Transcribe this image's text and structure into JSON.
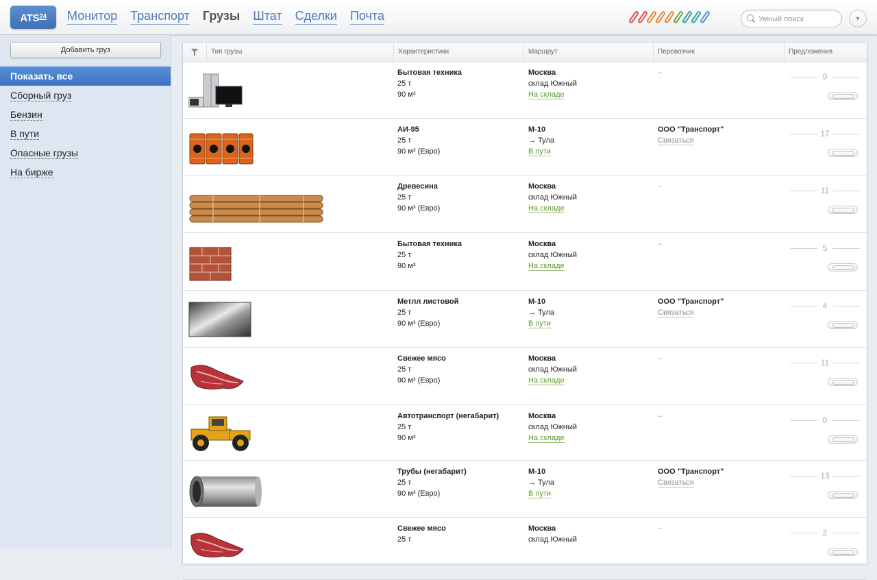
{
  "header": {
    "logo": "ATS",
    "logo_sup": "24",
    "nav": [
      {
        "label": "Монитор",
        "active": false
      },
      {
        "label": "Транспорт",
        "active": false
      },
      {
        "label": "Грузы",
        "active": true
      },
      {
        "label": "Штат",
        "active": false
      },
      {
        "label": "Сделки",
        "active": false
      },
      {
        "label": "Почта",
        "active": false
      }
    ],
    "clip_colors": [
      "#d9534f",
      "#d9534f",
      "#e8863a",
      "#e8863a",
      "#e8863a",
      "#6aac3b",
      "#2aa5a5",
      "#2aa5a5",
      "#5b8fd1"
    ],
    "search_placeholder": "Умный поиск",
    "menu_icon": "▼"
  },
  "sidebar": {
    "add_button": "Добавить груз",
    "items": [
      {
        "label": "Показать все",
        "active": true
      },
      {
        "label": "Сборный груз",
        "active": false
      },
      {
        "label": "Бензин",
        "active": false
      },
      {
        "label": "В пути",
        "active": false
      },
      {
        "label": "Опасные грузы",
        "active": false
      },
      {
        "label": "На бирже",
        "active": false
      }
    ]
  },
  "table": {
    "columns": [
      "Тип грузы",
      "Характеристики",
      "Маршрут",
      "Перевозчик",
      "Предложения"
    ],
    "rows": [
      {
        "image": "appliances",
        "name": "Бытовая техника",
        "weight": "25 т",
        "volume": "90 м³",
        "route_from": "Москва",
        "route_to": "склад Южный",
        "status": "На складе",
        "carrier": "–",
        "contact": "",
        "offers": "9"
      },
      {
        "image": "barrels",
        "name": "АИ-95",
        "weight": "25 т",
        "volume": "90 м³ (Евро)",
        "route_from": "М-10",
        "route_to": "→ Тула",
        "status": "В пути",
        "carrier": "ООО \"Транспорт\"",
        "contact": "Связаться",
        "offers": "17"
      },
      {
        "image": "logs",
        "name": "Древесина",
        "weight": "25 т",
        "volume": "90 м³ (Евро)",
        "route_from": "Москва",
        "route_to": "склад Южный",
        "status": "На складе",
        "carrier": "–",
        "contact": "",
        "offers": "11"
      },
      {
        "image": "bricks",
        "name": "Бытовая техника",
        "weight": "25 т",
        "volume": "90 м³",
        "route_from": "Москва",
        "route_to": "склад Южный",
        "status": "На складе",
        "carrier": "–",
        "contact": "",
        "offers": "5"
      },
      {
        "image": "metal-sheet",
        "name": "Метлл листовой",
        "weight": "25 т",
        "volume": "90 м³ (Евро)",
        "route_from": "М-10",
        "route_to": "→ Тула",
        "status": "В пути",
        "carrier": "ООО \"Транспорт\"",
        "contact": "Связаться",
        "offers": "4"
      },
      {
        "image": "meat",
        "name": "Свежее мясо",
        "weight": "25 т",
        "volume": "90 м³ (Евро)",
        "route_from": "Москва",
        "route_to": "склад Южный",
        "status": "На складе",
        "carrier": "–",
        "contact": "",
        "offers": "11"
      },
      {
        "image": "tractor",
        "name": "Автотранспорт (негабарит)",
        "weight": "25 т",
        "volume": "90 м³",
        "route_from": "Москва",
        "route_to": "склад Южный",
        "status": "На складе",
        "carrier": "–",
        "contact": "",
        "offers": "0"
      },
      {
        "image": "pipe",
        "name": "Трубы (негабарит)",
        "weight": "25 т",
        "volume": "90 м³ (Евро)",
        "route_from": "М-10",
        "route_to": "→ Тула",
        "status": "В пути",
        "carrier": "ООО \"Транспорт\"",
        "contact": "Связаться",
        "offers": "13"
      },
      {
        "image": "meat",
        "name": "Свежее мясо",
        "weight": "25 т",
        "volume": "",
        "route_from": "Москва",
        "route_to": "склад Южный",
        "status": "",
        "carrier": "–",
        "contact": "",
        "offers": "2"
      }
    ]
  }
}
